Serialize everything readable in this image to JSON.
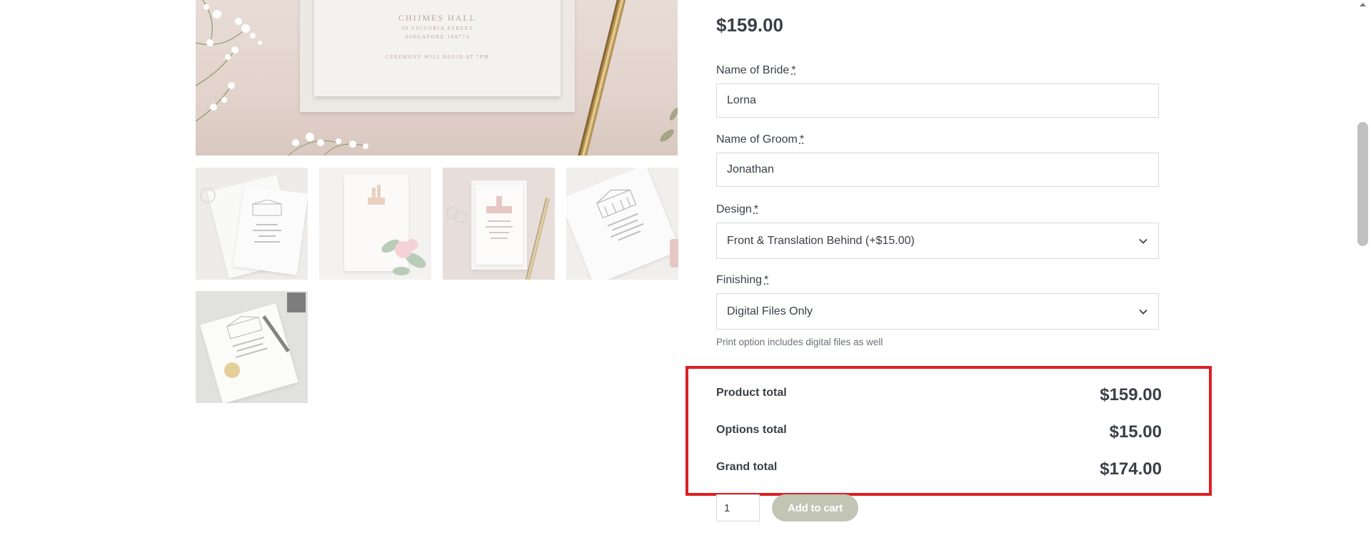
{
  "gallery": {
    "main_image": {
      "venue": "CHIJMES HALL",
      "address_line1": "30 VICTORIA STREET",
      "address_line2": "SINGAPORE 189774",
      "ceremony": "CEREMONY WILL BEGIN AT 7PM"
    },
    "thumbnails": [
      {
        "name": "thumbnail-1"
      },
      {
        "name": "thumbnail-2"
      },
      {
        "name": "thumbnail-3"
      },
      {
        "name": "thumbnail-4"
      },
      {
        "name": "thumbnail-5"
      }
    ]
  },
  "product": {
    "price": "$159.00",
    "fields": {
      "bride": {
        "label": "Name of Bride",
        "required_mark": "*",
        "value": "Lorna"
      },
      "groom": {
        "label": "Name of Groom",
        "required_mark": "*",
        "value": "Jonathan"
      },
      "design": {
        "label": "Design",
        "required_mark": "*",
        "selected": "Front & Translation Behind (+$15.00)"
      },
      "finishing": {
        "label": "Finishing",
        "required_mark": "*",
        "selected": "Digital Files Only",
        "helper": "Print option includes digital files as well"
      }
    },
    "totals": {
      "product_label": "Product total",
      "product_value": "$159.00",
      "options_label": "Options total",
      "options_value": "$15.00",
      "grand_label": "Grand total",
      "grand_value": "$174.00"
    },
    "quantity": "1",
    "add_to_cart_label": "Add to cart"
  },
  "colors": {
    "text": "#3a3f47",
    "highlight_border": "#dd1f26",
    "add_to_cart_bg": "#c2c4b4",
    "input_border": "#d6d9dd"
  },
  "icons": {
    "select_arrow": "chevron-down-icon",
    "scroll_arrow": "scroll-up-arrow-icon"
  }
}
